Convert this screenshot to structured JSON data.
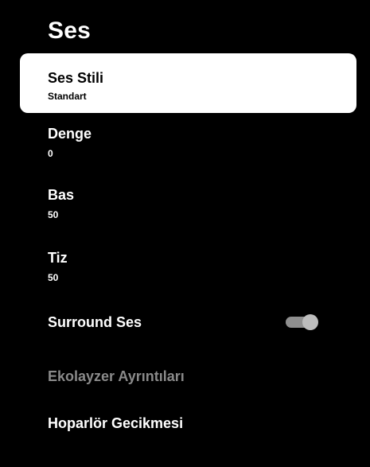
{
  "header": {
    "title": "Ses"
  },
  "menu": {
    "items": [
      {
        "label": "Ses Stili",
        "value": "Standart"
      },
      {
        "label": "Denge",
        "value": "0"
      },
      {
        "label": "Bas",
        "value": "50"
      },
      {
        "label": "Tiz",
        "value": "50"
      },
      {
        "label": "Surround Ses",
        "toggle_state": "on"
      },
      {
        "label": "Ekolayzer Ayrıntıları",
        "state": "disabled"
      },
      {
        "label": "Hoparlör Gecikmesi"
      }
    ]
  },
  "colors": {
    "background": "#000000",
    "selected_bg": "#ffffff",
    "disabled_text": "#8a8a8a",
    "toggle": "#bdbdbd"
  }
}
